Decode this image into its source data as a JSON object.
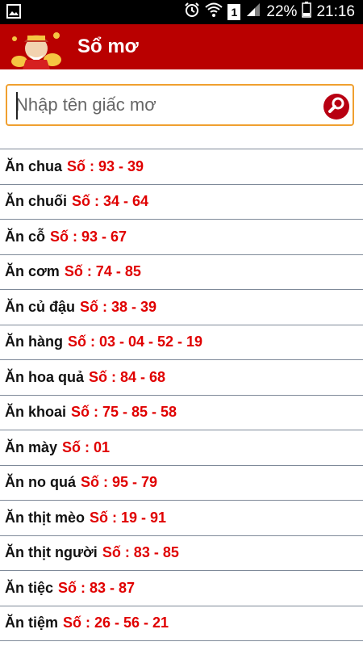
{
  "status": {
    "battery": "22%",
    "time": "21:16",
    "sim": "1"
  },
  "app": {
    "title": "Sổ mơ"
  },
  "search": {
    "placeholder": "Nhập tên giấc mơ",
    "value": ""
  },
  "colors": {
    "appbar": "#b90000",
    "number": "#e00000",
    "search_border": "#f0a030"
  },
  "icons": [
    "gallery-icon",
    "alarm-icon",
    "wifi-icon",
    "signal-icon",
    "battery-icon",
    "search-icon"
  ],
  "dreams": [
    {
      "name": "Ăn chua",
      "numbers": "Số : 93 - 39"
    },
    {
      "name": "Ăn chuối",
      "numbers": "Số : 34 - 64"
    },
    {
      "name": "Ăn cỗ",
      "numbers": "Số : 93 - 67"
    },
    {
      "name": "Ăn cơm",
      "numbers": "Số : 74 - 85"
    },
    {
      "name": "Ăn củ đậu",
      "numbers": "Số : 38 - 39"
    },
    {
      "name": "Ăn hàng",
      "numbers": "Số : 03 - 04 - 52 - 19"
    },
    {
      "name": "Ăn hoa quả",
      "numbers": "Số : 84 - 68"
    },
    {
      "name": "Ăn khoai",
      "numbers": "Số : 75 - 85 - 58"
    },
    {
      "name": "Ăn mày",
      "numbers": "Số : 01"
    },
    {
      "name": "Ăn no quá",
      "numbers": "Số : 95 - 79"
    },
    {
      "name": "Ăn thịt mèo",
      "numbers": "Số : 19 - 91"
    },
    {
      "name": "Ăn thịt người",
      "numbers": "Số : 83 - 85"
    },
    {
      "name": "Ăn tiệc",
      "numbers": "Số : 83 - 87"
    },
    {
      "name": "Ăn tiệm",
      "numbers": "Số : 26 - 56 - 21"
    }
  ]
}
